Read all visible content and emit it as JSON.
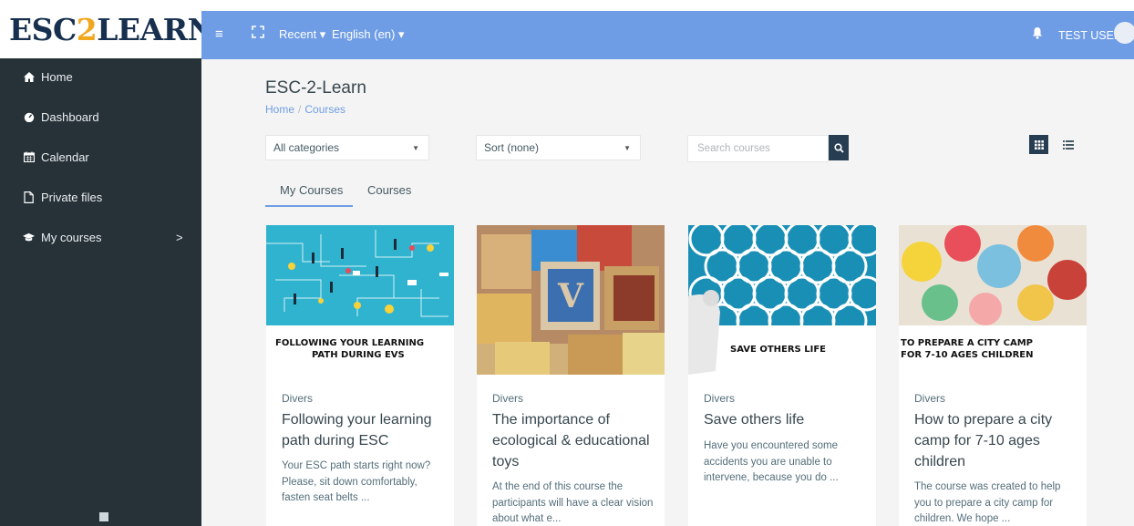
{
  "logo": {
    "part1": "ESC",
    "part2": "2",
    "part3": "LEARN"
  },
  "topbar": {
    "recent_label": "Recent ▾",
    "language_label": "English (en) ▾",
    "user_name": "TEST USER"
  },
  "sidebar": {
    "items": [
      {
        "label": "Home",
        "icon": "home-icon"
      },
      {
        "label": "Dashboard",
        "icon": "dashboard-icon"
      },
      {
        "label": "Calendar",
        "icon": "calendar-icon"
      },
      {
        "label": "Private files",
        "icon": "file-icon"
      },
      {
        "label": "My courses",
        "icon": "graduation-cap-icon",
        "chevron": ">"
      }
    ]
  },
  "main": {
    "title": "ESC-2-Learn",
    "breadcrumb": {
      "home": "Home",
      "separator": "/",
      "current": "Courses"
    },
    "filters": {
      "category_value": "All categories",
      "sort_value": "Sort (none)",
      "search_placeholder": "Search courses"
    },
    "tabs": [
      {
        "label": "My Courses",
        "active": true
      },
      {
        "label": "Courses",
        "active": false
      }
    ],
    "courses": [
      {
        "category": "Divers",
        "name": "Following your learning path during ESC",
        "description": "Your ESC path starts right now? Please, sit down comfortably, fasten seat belts ...",
        "image_caption_1": "FOLLOWING YOUR LEARNING",
        "image_caption_2": "PATH DURING EVS"
      },
      {
        "category": "Divers",
        "name": "The importance of ecological & educational toys",
        "description": "At the end of this course the participants will have a clear vision about what e..."
      },
      {
        "category": "Divers",
        "name": "Save others life",
        "description": "Have you encountered some accidents you are unable to intervene, because you do ...",
        "image_caption_1": "SAVE OTHERS LIFE"
      },
      {
        "category": "Divers",
        "name": "How to prepare a city camp for 7-10 ages children",
        "description": "The course was created to help you to prepare a city camp for children. We hope ...",
        "image_caption_1": "TO PREPARE A CITY CAMP",
        "image_caption_2": "FOR 7-10 AGES CHILDREN"
      }
    ]
  },
  "colors": {
    "topbar": "#6f9de5",
    "sidebar": "#263238",
    "logo_navy": "#17304f",
    "logo_accent": "#f0a820",
    "button_dark": "#263d52"
  }
}
